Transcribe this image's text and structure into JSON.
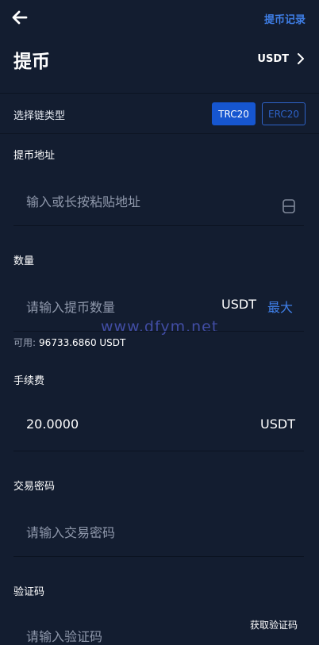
{
  "header": {
    "history_link": "提币记录",
    "title": "提币",
    "currency": "USDT"
  },
  "chain": {
    "label": "选择链类型",
    "options": [
      "TRC20",
      "ERC20"
    ],
    "selected": "TRC20"
  },
  "address": {
    "label": "提币地址",
    "placeholder": "输入或长按粘贴地址"
  },
  "amount": {
    "label": "数量",
    "placeholder": "请输入提币数量",
    "unit": "USDT",
    "max_label": "最大",
    "available_label": "可用:",
    "available_value": "96733.6860 USDT"
  },
  "watermark": "www.dfym.net",
  "fee": {
    "label": "手续费",
    "value": "20.0000",
    "unit": "USDT"
  },
  "password": {
    "label": "交易密码",
    "placeholder": "请输入交易密码"
  },
  "verify": {
    "label": "验证码",
    "placeholder": "请输入验证码",
    "get_code": "获取验证码"
  },
  "icons": {
    "back": "arrow-left-icon",
    "currency": "chevron-right-icon",
    "scan": "scan-icon"
  },
  "colors": {
    "background": "#131d30",
    "accent": "#3f7fe8",
    "chip_active": "#1656d0",
    "placeholder": "#8f98ab"
  }
}
